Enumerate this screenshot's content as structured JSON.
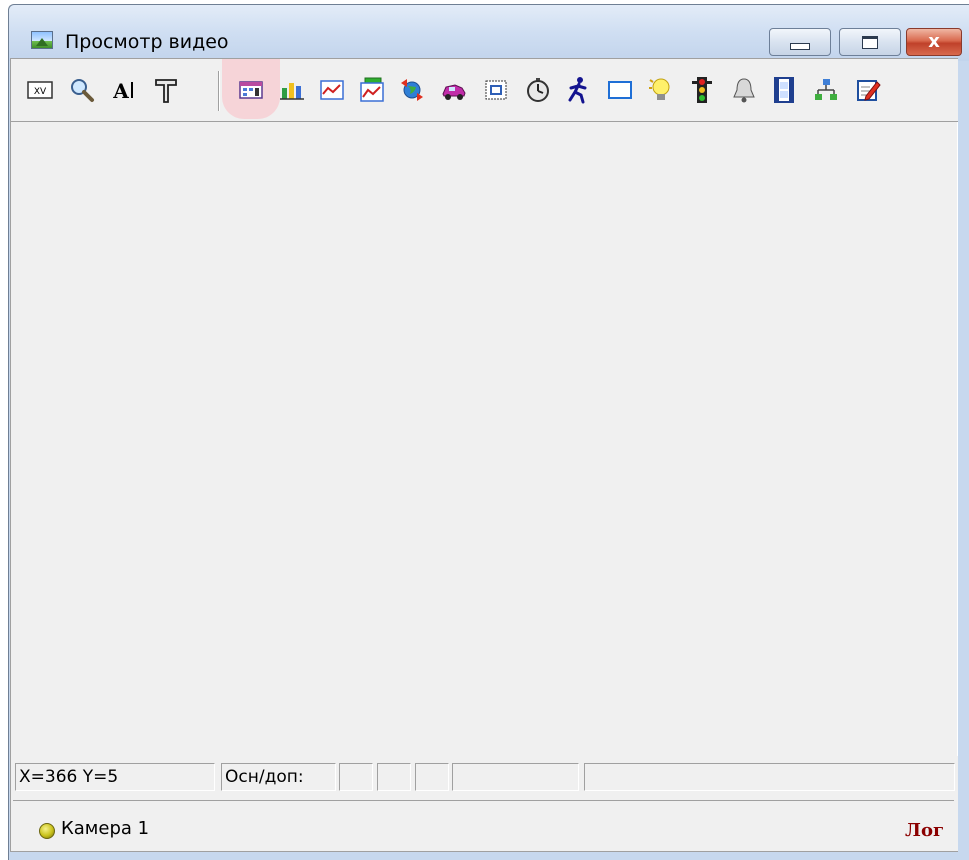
{
  "window": {
    "title": "Просмотр видео",
    "close_glyph": "x"
  },
  "toolbar": {
    "icons": [
      {
        "name": "xv-icon",
        "label": "XV"
      },
      {
        "name": "magnifier-icon"
      },
      {
        "name": "text-tool-icon",
        "label": "A"
      },
      {
        "name": "hammer-icon"
      },
      {
        "name": "grid-settings-icon"
      },
      {
        "name": "chart-3d-icon"
      },
      {
        "name": "line-chart-icon"
      },
      {
        "name": "chart-monitor-icon"
      },
      {
        "name": "globe-arrows-icon"
      },
      {
        "name": "car-icon"
      },
      {
        "name": "text-frame-icon"
      },
      {
        "name": "stopwatch-icon"
      },
      {
        "name": "running-man-icon"
      },
      {
        "name": "window-frame-icon"
      },
      {
        "name": "light-bulb-icon"
      },
      {
        "name": "traffic-light-icon"
      },
      {
        "name": "bell-icon"
      },
      {
        "name": "film-icon"
      },
      {
        "name": "network-icon"
      },
      {
        "name": "edit-note-icon"
      }
    ],
    "highlighted_index": 4
  },
  "status": {
    "coords": "X=366 Y=5",
    "mode": "Осн/доп:"
  },
  "tabbar": {
    "camera": "Камера 1",
    "log": "Лог"
  },
  "colors": {
    "log": "#8b0000",
    "highlight": "#f6d4d8"
  }
}
